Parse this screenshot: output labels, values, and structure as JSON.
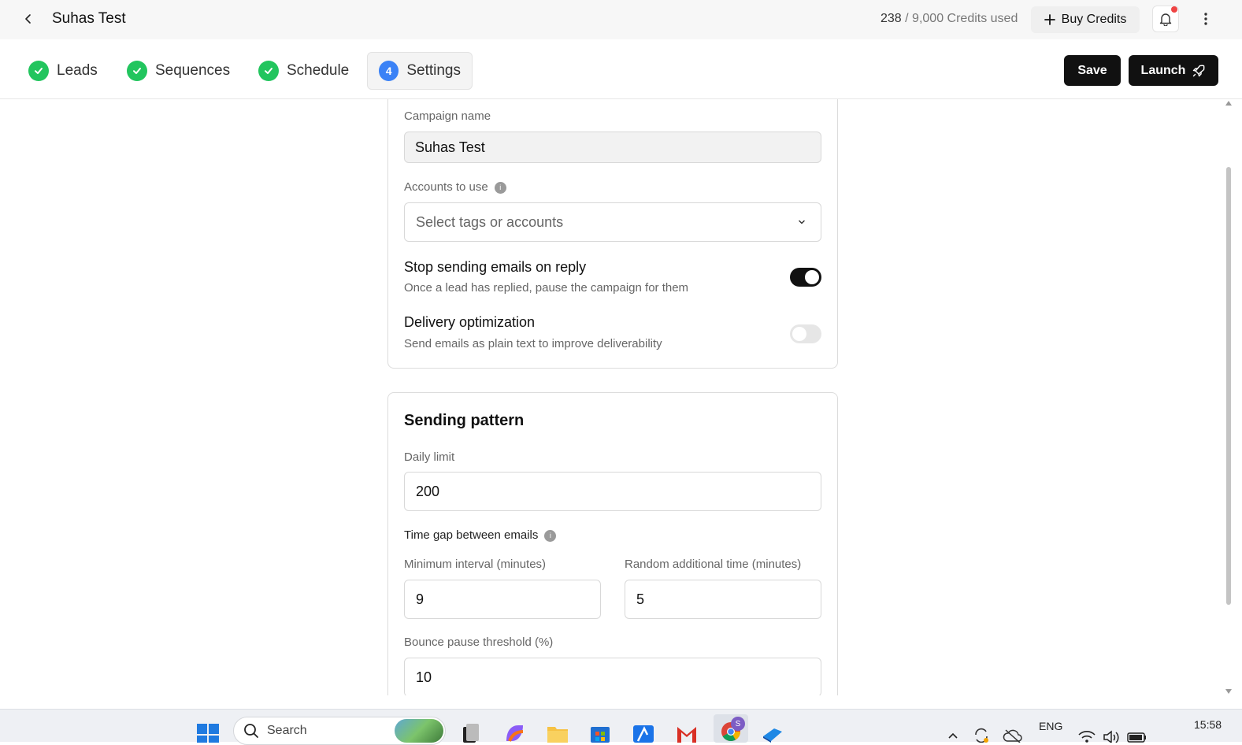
{
  "header": {
    "title": "Suhas Test",
    "credits_used": "238",
    "credits_total": "/ 9,000 Credits used",
    "buy_credits_label": "Buy Credits"
  },
  "steps": [
    {
      "label": "Leads",
      "status": "done"
    },
    {
      "label": "Sequences",
      "status": "done"
    },
    {
      "label": "Schedule",
      "status": "done"
    },
    {
      "label": "Settings",
      "status": "active",
      "number": "4"
    }
  ],
  "actions": {
    "save_label": "Save",
    "launch_label": "Launch"
  },
  "general": {
    "campaign_name_label": "Campaign name",
    "campaign_name_value": "Suhas Test",
    "accounts_label": "Accounts to use",
    "accounts_placeholder": "Select tags or accounts",
    "stop_on_reply_title": "Stop sending emails on reply",
    "stop_on_reply_desc": "Once a lead has replied, pause the campaign for them",
    "stop_on_reply_on": true,
    "delivery_opt_title": "Delivery optimization",
    "delivery_opt_desc": "Send emails as plain text to improve deliverability",
    "delivery_opt_on": false
  },
  "sending_pattern": {
    "title": "Sending pattern",
    "daily_limit_label": "Daily limit",
    "daily_limit_value": "200",
    "time_gap_label": "Time gap between emails",
    "min_interval_label": "Minimum interval (minutes)",
    "min_interval_value": "9",
    "random_time_label": "Random additional time (minutes)",
    "random_time_value": "5",
    "bounce_label": "Bounce pause threshold (%)",
    "bounce_value": "10"
  },
  "taskbar": {
    "search_placeholder": "Search",
    "language": "ENG",
    "time": "15:58"
  },
  "colors": {
    "check_green": "#22c55e",
    "step_blue": "#3b82f6",
    "primary_dark": "#111111",
    "notification_red": "#ef4444"
  }
}
